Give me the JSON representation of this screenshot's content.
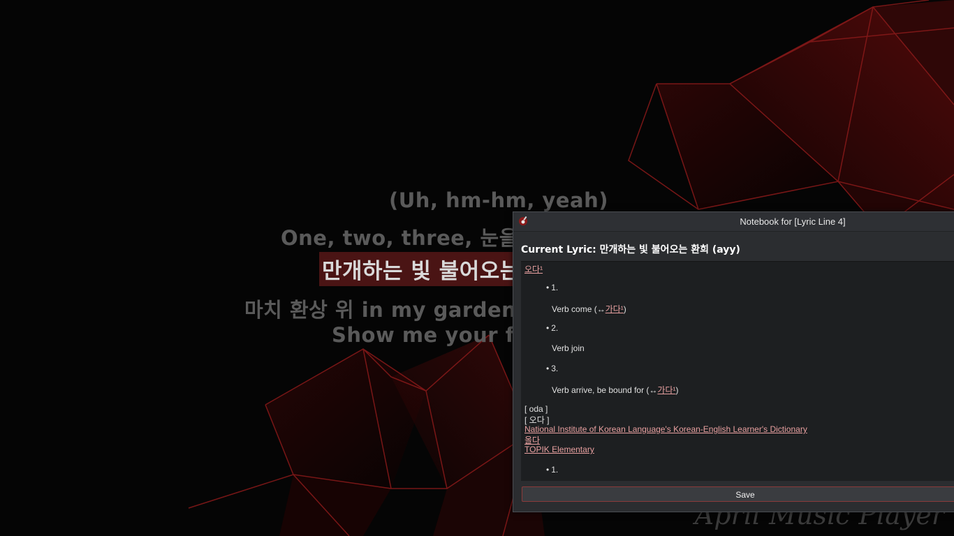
{
  "lyrics": {
    "line_prev2": "(Uh, hm-hm, yeah)",
    "line_prev1": "One, two, three, 눈을 뜨면",
    "line_current": "만개하는 빛 불어오는 환희",
    "line_next1": "마치 환상 위 in my garden, so",
    "line_next2": "Show me your flow"
  },
  "watermark": "April Music Player",
  "notebook": {
    "title": "Notebook for [Lyric Line 4]",
    "current_lyric_label": "Current Lyric:",
    "current_lyric_value": " 만개하는 빛 불어오는 환희 (ayy)",
    "entry_headword": "오다¹",
    "senses": [
      {
        "num": "1.",
        "def_prefix": "Verb come (↔",
        "link": "가다¹",
        "def_suffix": ")"
      },
      {
        "num": "2.",
        "def_prefix": "Verb join",
        "link": "",
        "def_suffix": ""
      },
      {
        "num": "3.",
        "def_prefix": "Verb arrive, be bound for (↔",
        "link": "가다¹",
        "def_suffix": ")"
      }
    ],
    "romanization": "[ oda ]",
    "pronunciation": "[  오다  ]",
    "dictionary_source": "National Institute of Korean Language's Korean-English Learner's Dictionary",
    "inflection_link": "올다",
    "level_link": "TOPIK Elementary",
    "next_sense_num": "1.",
    "save_label": "Save"
  },
  "colors": {
    "accent": "#8a3a3a",
    "link": "#e8a0a0",
    "highlight_bg": "#4a1414"
  }
}
